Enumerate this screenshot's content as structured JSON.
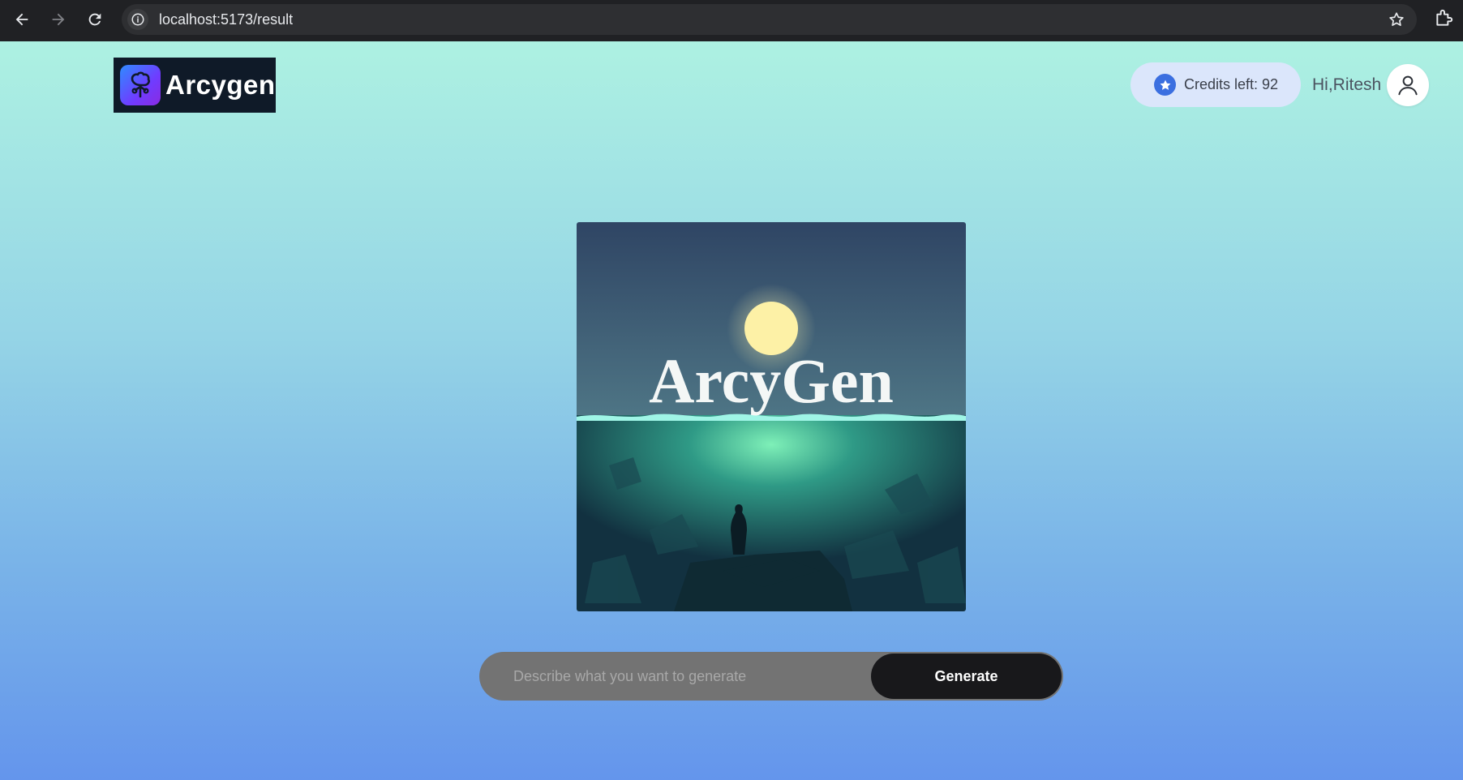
{
  "browser": {
    "url": "localhost:5173/result"
  },
  "header": {
    "logo_text": "Arcygen",
    "credits_label": "Credits left: 92",
    "greeting": "Hi,Ritesh"
  },
  "result": {
    "image_title": "ArcyGen"
  },
  "prompt": {
    "placeholder": "Describe what you want to generate",
    "value": "",
    "generate_label": "Generate"
  },
  "colors": {
    "accent": "#3b6fe0",
    "button": "#18181b",
    "credits_bg": "#dbe6fb"
  }
}
